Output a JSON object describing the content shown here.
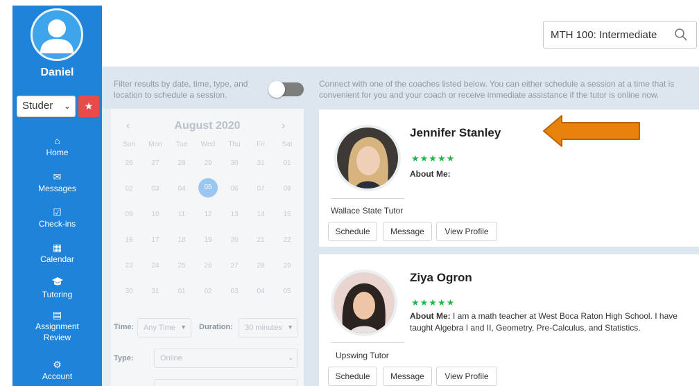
{
  "user": {
    "name": "Daniel",
    "role_select": "Studer"
  },
  "nav": [
    {
      "key": "home",
      "label": "Home",
      "icon": "home-icon",
      "glyph": "⌂"
    },
    {
      "key": "messages",
      "label": "Messages",
      "icon": "envelope-icon",
      "glyph": "✉"
    },
    {
      "key": "checkins",
      "label": "Check-ins",
      "icon": "checkbox-icon",
      "glyph": "☑"
    },
    {
      "key": "calendar",
      "label": "Calendar",
      "icon": "calendar-icon",
      "glyph": "▦"
    },
    {
      "key": "tutoring",
      "label": "Tutoring",
      "icon": "graduation-cap-icon",
      "glyph": "⌂"
    },
    {
      "key": "assignment",
      "label": "Assignment Review",
      "icon": "document-icon",
      "glyph": "▤"
    },
    {
      "key": "account",
      "label": "Account",
      "icon": "gear-icon",
      "glyph": "⚙"
    }
  ],
  "search": {
    "value": "MTH 100: Intermediate"
  },
  "filter_text": "Filter results by date, time, type, and location to schedule a session.",
  "connect_text": "Connect with one of the coaches listed below. You can either schedule a session at a time that is convenient for you and your coach or receive immediate assistance if the tutor is online now.",
  "calendar": {
    "month": "August 2020",
    "prev": "‹",
    "next": "›",
    "days_of_week": [
      "Sun",
      "Mon",
      "Tue",
      "Wed",
      "Thu",
      "Fri",
      "Sat"
    ],
    "weeks": [
      [
        "26",
        "27",
        "28",
        "29",
        "30",
        "31",
        "01"
      ],
      [
        "02",
        "03",
        "04",
        "05",
        "06",
        "07",
        "08"
      ],
      [
        "09",
        "10",
        "11",
        "12",
        "13",
        "14",
        "15"
      ],
      [
        "16",
        "17",
        "18",
        "19",
        "20",
        "21",
        "22"
      ],
      [
        "23",
        "24",
        "25",
        "26",
        "27",
        "28",
        "29"
      ],
      [
        "30",
        "31",
        "01",
        "02",
        "03",
        "04",
        "05"
      ]
    ],
    "selected_day": "05",
    "time_label": "Time:",
    "time_value": "Any Time",
    "duration_label": "Duration:",
    "duration_value": "30 minutes",
    "type_label": "Type:",
    "type_value": "Online"
  },
  "tutors": [
    {
      "name": "Jennifer Stanley",
      "stars": "★★★★★",
      "about_label": "About Me:",
      "about_text": "",
      "school": "Wallace State Tutor",
      "buttons": [
        "Schedule",
        "Message",
        "View Profile"
      ]
    },
    {
      "name": "Ziya Ogron",
      "stars": "★★★★★",
      "about_label": "About Me:",
      "about_text": " I am a math teacher at West Boca Raton High School. I have taught Algebra I and II, Geometry, Pre-Calculus, and Statistics.",
      "school": "Upswing Tutor",
      "buttons": [
        "Schedule",
        "Message",
        "View Profile"
      ]
    }
  ],
  "colors": {
    "sidebar": "#1e83d9",
    "stars": "#2cb54a",
    "star_button": "#e74c4c",
    "arrow": "#e8820c"
  }
}
